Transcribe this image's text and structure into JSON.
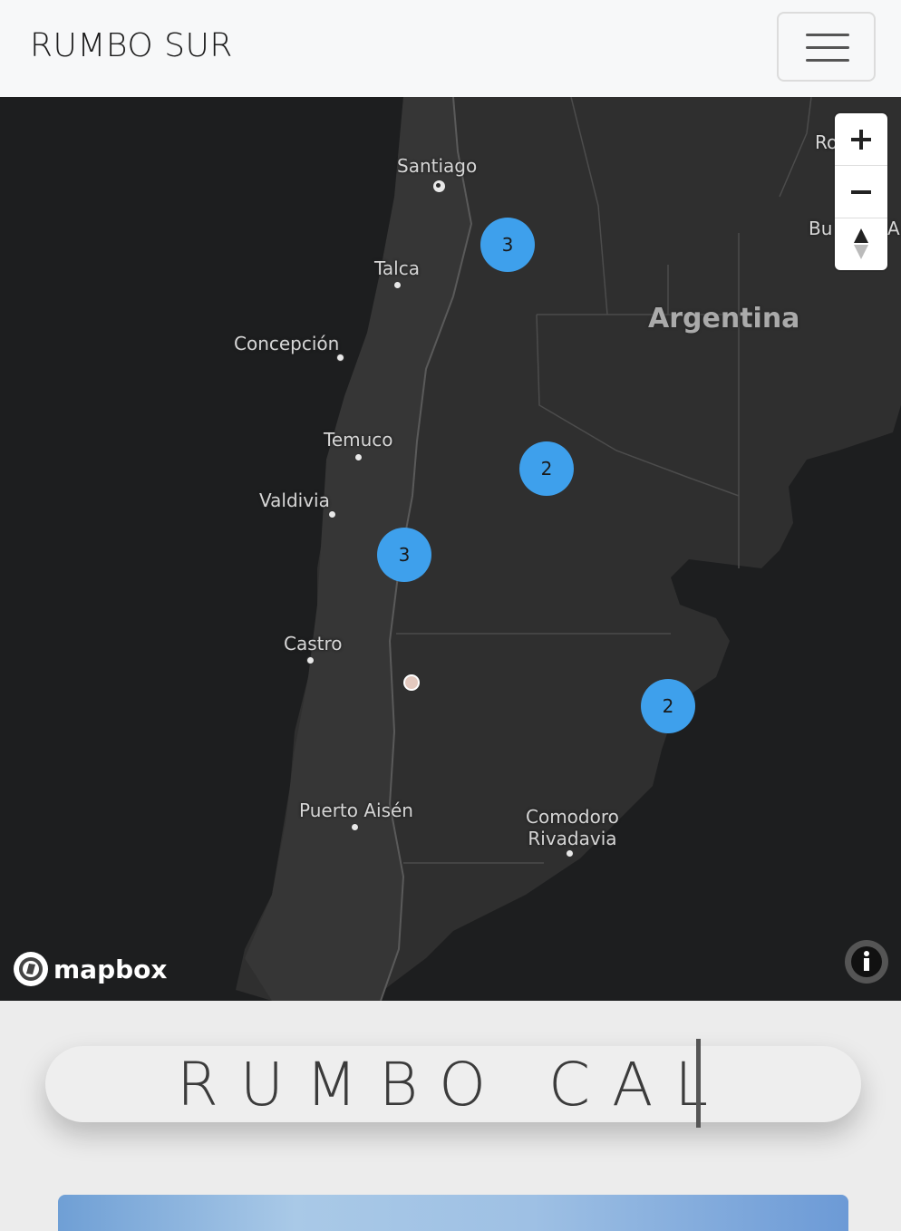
{
  "navbar": {
    "brand": "RUMBO SUR",
    "menu_icon": "hamburger-menu-icon"
  },
  "map": {
    "provider_logo": "mapbox",
    "country_label": "Argentina",
    "partial_labels": [
      "Ro",
      "Bu",
      "A"
    ],
    "cities": [
      {
        "name": "Santiago",
        "capital": true
      },
      {
        "name": "Talca"
      },
      {
        "name": "Concepción"
      },
      {
        "name": "Temuco"
      },
      {
        "name": "Valdivia"
      },
      {
        "name": "Castro"
      },
      {
        "name": "Puerto Aisén"
      },
      {
        "name": "Comodoro\nRivadavia"
      }
    ],
    "clusters": [
      {
        "count": "3"
      },
      {
        "count": "2"
      },
      {
        "count": "3"
      },
      {
        "count": "2"
      }
    ],
    "controls": {
      "zoom_in": "plus-icon",
      "zoom_out": "minus-icon",
      "compass": "compass-icon"
    },
    "info_icon": "info-icon",
    "cluster_color": "#3ea0ec"
  },
  "hero": {
    "title": "RUMBO CAL"
  }
}
